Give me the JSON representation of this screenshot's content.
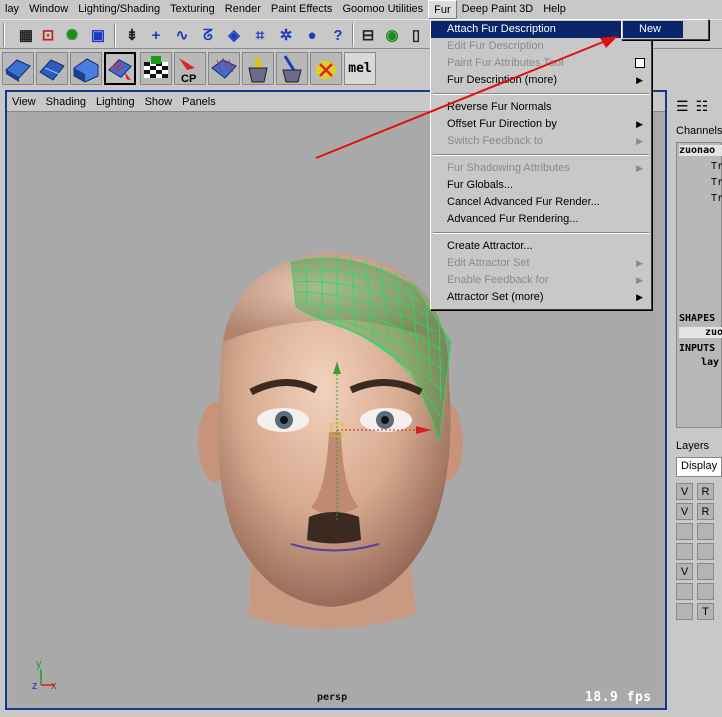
{
  "menubar": {
    "items": [
      "lay",
      "Window",
      "Lighting/Shading",
      "Texturing",
      "Render",
      "Paint Effects",
      "Goomoo Utilities",
      "Fur",
      "Deep Paint 3D",
      "Help"
    ],
    "active": "Fur"
  },
  "toolbar": {
    "icons": [
      "select-by-object-icon",
      "snap-icon",
      "component-icon",
      "shelf-toggle-icon",
      "move-plus-icon",
      "curve-icon",
      "lasso-icon",
      "transform-icon",
      "grid-icon",
      "light-icon",
      "help-icon",
      "lock-icon",
      "render-icon",
      "ipr-icon",
      "hypershade-icon",
      "fur-icon"
    ]
  },
  "shelf": {
    "items": [
      {
        "name": "fur-shelf-icon-1",
        "label": ""
      },
      {
        "name": "fur-shelf-icon-2",
        "label": ""
      },
      {
        "name": "fur-shelf-icon-3",
        "label": ""
      },
      {
        "name": "fur-shelf-icon-4",
        "label": ""
      },
      {
        "name": "checker-fur-icon",
        "label": ""
      },
      {
        "name": "copy-fur-icon",
        "label": "CP"
      },
      {
        "name": "paint-fur-icon",
        "label": ""
      },
      {
        "name": "bucket-icon",
        "label": ""
      },
      {
        "name": "brush-bucket-icon",
        "label": ""
      },
      {
        "name": "delete-fur-icon",
        "label": ""
      },
      {
        "name": "mel-icon",
        "label": "mel"
      }
    ]
  },
  "viewport": {
    "menu": [
      "View",
      "Shading",
      "Lighting",
      "Show",
      "Panels"
    ],
    "camera": "persp",
    "fps": "18.9 fps",
    "axis": {
      "y": "y",
      "z": "z",
      "x": "x"
    }
  },
  "rightpanel": {
    "channels_tab": "Channels",
    "object_name": "zuonao",
    "attr_rows": [
      "Tr",
      "Tr",
      "Tr"
    ],
    "shapes_header": "SHAPES",
    "shape_item": "zuo",
    "inputs_header": "INPUTS",
    "input_item": "lay",
    "layers_tab": "Layers",
    "display_value": "Display",
    "layer_rows": [
      {
        "v": "V",
        "r": "R"
      },
      {
        "v": "V",
        "r": "R"
      },
      {
        "v": "",
        "r": ""
      },
      {
        "v": "",
        "r": ""
      },
      {
        "v": "V",
        "r": ""
      },
      {
        "v": "",
        "r": ""
      },
      {
        "v": "",
        "r": "T"
      }
    ]
  },
  "fur_menu": {
    "groups": [
      [
        {
          "label": "Attach Fur Description",
          "submenu": true,
          "highlight": true,
          "disabled": false
        },
        {
          "label": "Edit Fur Description",
          "submenu": false,
          "disabled": true
        },
        {
          "label": "Paint Fur Attributes Tool",
          "submenu": false,
          "disabled": true,
          "option_box": true
        },
        {
          "label": "Fur Description (more)",
          "submenu": true,
          "disabled": false
        }
      ],
      [
        {
          "label": "Reverse Fur Normals",
          "submenu": false,
          "disabled": false
        },
        {
          "label": "Offset Fur Direction by",
          "submenu": true,
          "disabled": false
        },
        {
          "label": "Switch Feedback to",
          "submenu": true,
          "disabled": true
        }
      ],
      [
        {
          "label": "Fur Shadowing Attributes",
          "submenu": true,
          "disabled": true
        },
        {
          "label": "Fur Globals...",
          "submenu": false,
          "disabled": false
        },
        {
          "label": "Cancel Advanced Fur Render...",
          "submenu": false,
          "disabled": false
        },
        {
          "label": "Advanced Fur Rendering...",
          "submenu": false,
          "disabled": false
        }
      ],
      [
        {
          "label": "Create Attractor...",
          "submenu": false,
          "disabled": false
        },
        {
          "label": "Edit Attractor Set",
          "submenu": true,
          "disabled": true
        },
        {
          "label": "Enable Feedback for",
          "submenu": true,
          "disabled": true
        },
        {
          "label": "Attractor Set (more)",
          "submenu": true,
          "disabled": false
        }
      ]
    ]
  },
  "submenu": {
    "label": "New"
  },
  "colors": {
    "highlight": "#0a246a",
    "viewport_border": "#123a8a",
    "annotation_arrow": "#e01010",
    "fur_grid": "#20e060"
  }
}
